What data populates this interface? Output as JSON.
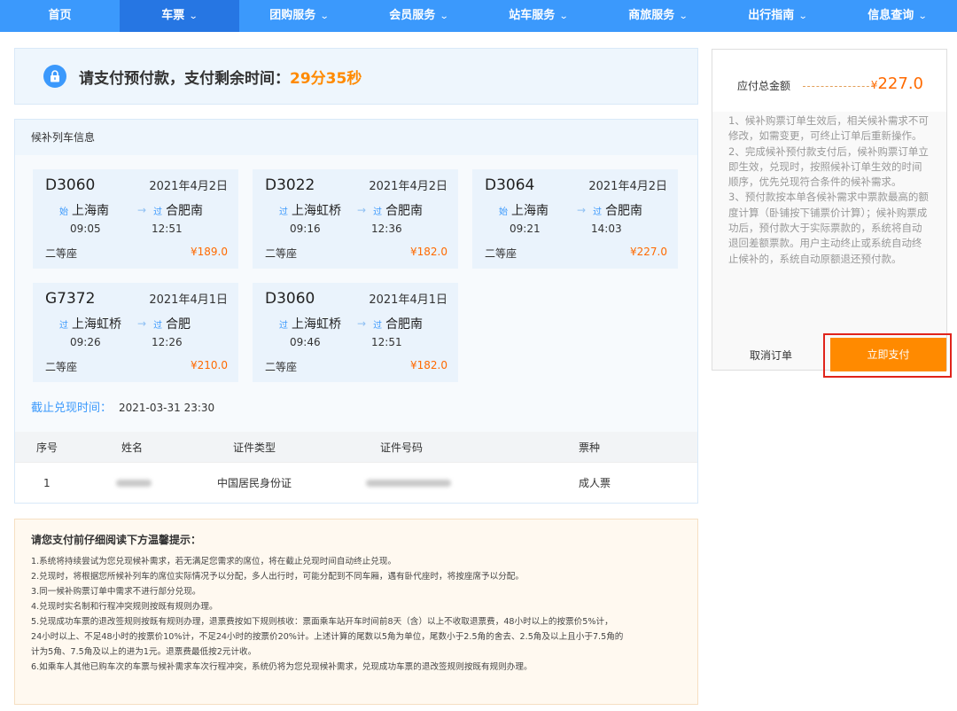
{
  "nav": {
    "items": [
      {
        "label": "首页",
        "has_dropdown": false,
        "active": false
      },
      {
        "label": "车票",
        "has_dropdown": true,
        "active": true
      },
      {
        "label": "团购服务",
        "has_dropdown": true,
        "active": false
      },
      {
        "label": "会员服务",
        "has_dropdown": true,
        "active": false
      },
      {
        "label": "站车服务",
        "has_dropdown": true,
        "active": false
      },
      {
        "label": "商旅服务",
        "has_dropdown": true,
        "active": false
      },
      {
        "label": "出行指南",
        "has_dropdown": true,
        "active": false
      },
      {
        "label": "信息查询",
        "has_dropdown": true,
        "active": false
      }
    ],
    "chevron": "⌄"
  },
  "banner": {
    "text": "请支付预付款，支付剩余时间：",
    "time": "29分35秒"
  },
  "trains": {
    "header": "候补列车信息",
    "items": [
      {
        "code": "D3060",
        "date": "2021年4月2日",
        "from_tag": "始",
        "from": "上海南",
        "to_tag": "过",
        "to": "合肥南",
        "depart": "09:05",
        "arrive": "12:51",
        "seat": "二等座",
        "price": "¥189.0"
      },
      {
        "code": "D3022",
        "date": "2021年4月2日",
        "from_tag": "过",
        "from": "上海虹桥",
        "to_tag": "过",
        "to": "合肥南",
        "depart": "09:16",
        "arrive": "12:36",
        "seat": "二等座",
        "price": "¥182.0"
      },
      {
        "code": "D3064",
        "date": "2021年4月2日",
        "from_tag": "始",
        "from": "上海南",
        "to_tag": "过",
        "to": "合肥南",
        "depart": "09:21",
        "arrive": "14:03",
        "seat": "二等座",
        "price": "¥227.0"
      },
      {
        "code": "G7372",
        "date": "2021年4月1日",
        "from_tag": "过",
        "from": "上海虹桥",
        "to_tag": "过",
        "to": "合肥",
        "depart": "09:26",
        "arrive": "12:26",
        "seat": "二等座",
        "price": "¥210.0"
      },
      {
        "code": "D3060",
        "date": "2021年4月1日",
        "from_tag": "过",
        "from": "上海虹桥",
        "to_tag": "过",
        "to": "合肥南",
        "depart": "09:46",
        "arrive": "12:51",
        "seat": "二等座",
        "price": "¥182.0"
      }
    ],
    "arrow": "→",
    "deadline_label": "截止兑现时间：",
    "deadline_value": "2021-03-31 23:30"
  },
  "passengers": {
    "columns": [
      "序号",
      "姓名",
      "证件类型",
      "证件号码",
      "票种"
    ],
    "rows": [
      {
        "index": "1",
        "id_type": "中国居民身份证",
        "ticket_type": "成人票"
      }
    ]
  },
  "notice": {
    "title": "请您支付前仔细阅读下方温馨提示：",
    "lines": [
      "1.系统将持续尝试为您兑现候补需求，若无满足您需求的席位，将在截止兑现时间自动终止兑现。",
      "2.兑现时，将根据您所候补列车的席位实际情况予以分配，多人出行时，可能分配到不同车厢，遇有卧代座时，将按座席予以分配。",
      "3.同一候补购票订单中需求不进行部分兑现。",
      "4.兑现时实名制和行程冲突规则按既有规则办理。",
      "5.兑现成功车票的退改签规则按既有规则办理，退票费按如下规则核收：票面乘车站开车时间前8天（含）以上不收取退票费，48小时以上的按票价5%计，",
      "24小时以上、不足48小时的按票价10%计，不足24小时的按票价20%计。上述计算的尾数以5角为单位，尾数小于2.5角的舍去、2.5角及以上且小于7.5角的",
      "计为5角、7.5角及以上的进为1元。退票费最低按2元计收。",
      "6.如乘车人其他已购车次的车票与候补需求车次行程冲突，系统仍将为您兑现候补需求，兑现成功车票的退改签规则按既有规则办理。"
    ]
  },
  "sidebar": {
    "total_label": "应付总金额",
    "currency": "¥",
    "total_value": "227.0",
    "rules": [
      "1、候补购票订单生效后，相关候补需求不可修改，如需变更，可终止订单后重新操作。",
      "2、完成候补预付款支付后，候补购票订单立即生效，兑现时，按照候补订单生效的时间顺序，优先兑现符合条件的候补需求。",
      "3、预付款按本单各候补需求中票款最高的额度计算（卧铺按下铺票价计算）；候补购票成功后，预付款大于实际票款的，系统将自动退回差额票款。用户主动终止或系统自动终止候补的，系统自动原额退还预付款。"
    ],
    "cancel_label": "取消订单",
    "pay_label": "立即支付"
  }
}
